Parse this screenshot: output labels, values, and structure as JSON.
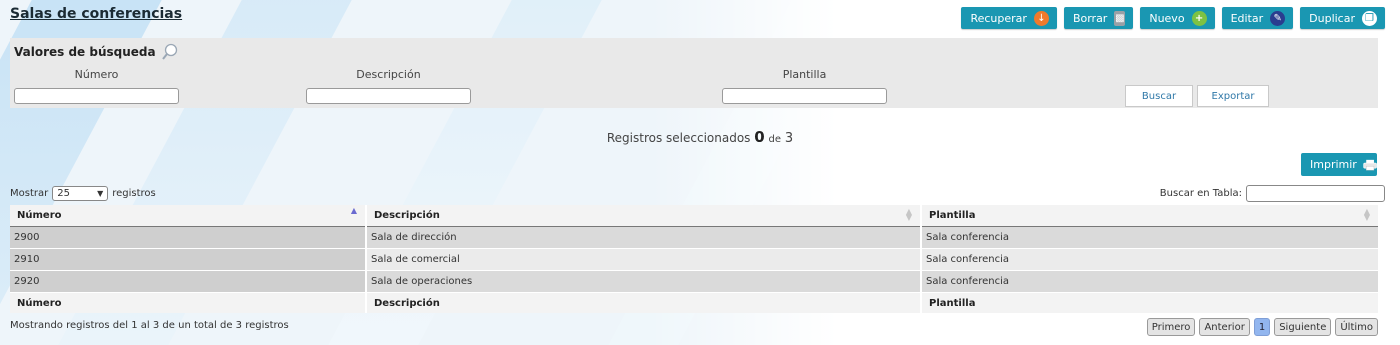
{
  "title": "Salas de conferencias",
  "toolbar": [
    {
      "label": "Recuperar",
      "icon": "download-arrow-icon",
      "color": "#f07a2c"
    },
    {
      "label": "Borrar",
      "icon": "trash-icon",
      "color": "#9aa0a6"
    },
    {
      "label": "Nuevo",
      "icon": "plus-icon",
      "color": "#7dc243"
    },
    {
      "label": "Editar",
      "icon": "pencil-icon",
      "color": "#2a3d8f"
    },
    {
      "label": "Duplicar",
      "icon": "duplicate-icon",
      "color": "#ffffff"
    }
  ],
  "search": {
    "title": "Valores de búsqueda",
    "fields": [
      {
        "label": "Número",
        "value": ""
      },
      {
        "label": "Descripción",
        "value": ""
      },
      {
        "label": "Plantilla",
        "value": ""
      }
    ],
    "buscar_label": "Buscar",
    "exportar_label": "Exportar"
  },
  "selection": {
    "prefix": "Registros seleccionados",
    "selected": "0",
    "of_label": "de",
    "total": "3"
  },
  "print_label": "Imprimir",
  "length": {
    "prefix": "Mostrar",
    "value": "25",
    "suffix": "registros"
  },
  "table_search_label": "Buscar en Tabla:",
  "table": {
    "columns": [
      "Número",
      "Descripción",
      "Plantilla"
    ],
    "rows": [
      [
        "2900",
        "Sala de dirección",
        "Sala conferencia"
      ],
      [
        "2910",
        "Sala de comercial",
        "Sala conferencia"
      ],
      [
        "2920",
        "Sala de operaciones",
        "Sala conferencia"
      ]
    ]
  },
  "info": "Mostrando registros del 1 al 3 de un total de 3 registros",
  "pager": {
    "first": "Primero",
    "prev": "Anterior",
    "current": "1",
    "next": "Siguiente",
    "last": "Último"
  },
  "colors": {
    "accent": "#1a97b2",
    "panel": "#e9e9e9",
    "page_current": "#92b6ef"
  }
}
